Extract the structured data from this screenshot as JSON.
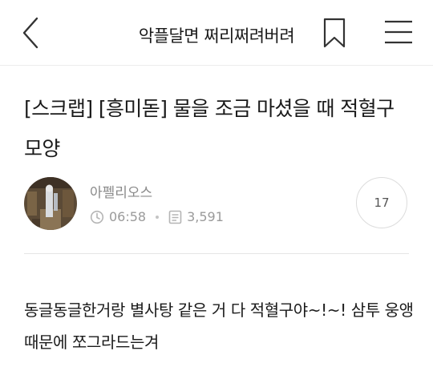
{
  "header": {
    "cafe_title": "악플달면 쩌리쩌려버려",
    "back_icon": "chevron-left-icon",
    "bookmark_icon": "bookmark-icon",
    "menu_icon": "hamburger-menu-icon"
  },
  "post": {
    "title": "[스크랩] [흥미돋] 물을 조금 마셨을 때 적혈구 모양",
    "author": "아펠리오스",
    "time": "06:58",
    "views": "3,591",
    "comment_count": "17",
    "body": "동글동글한거랑 별사탕 같은 거 다 적혈구야~!~! 삼투 웅앵 때문에 쪼그라드는겨"
  }
}
